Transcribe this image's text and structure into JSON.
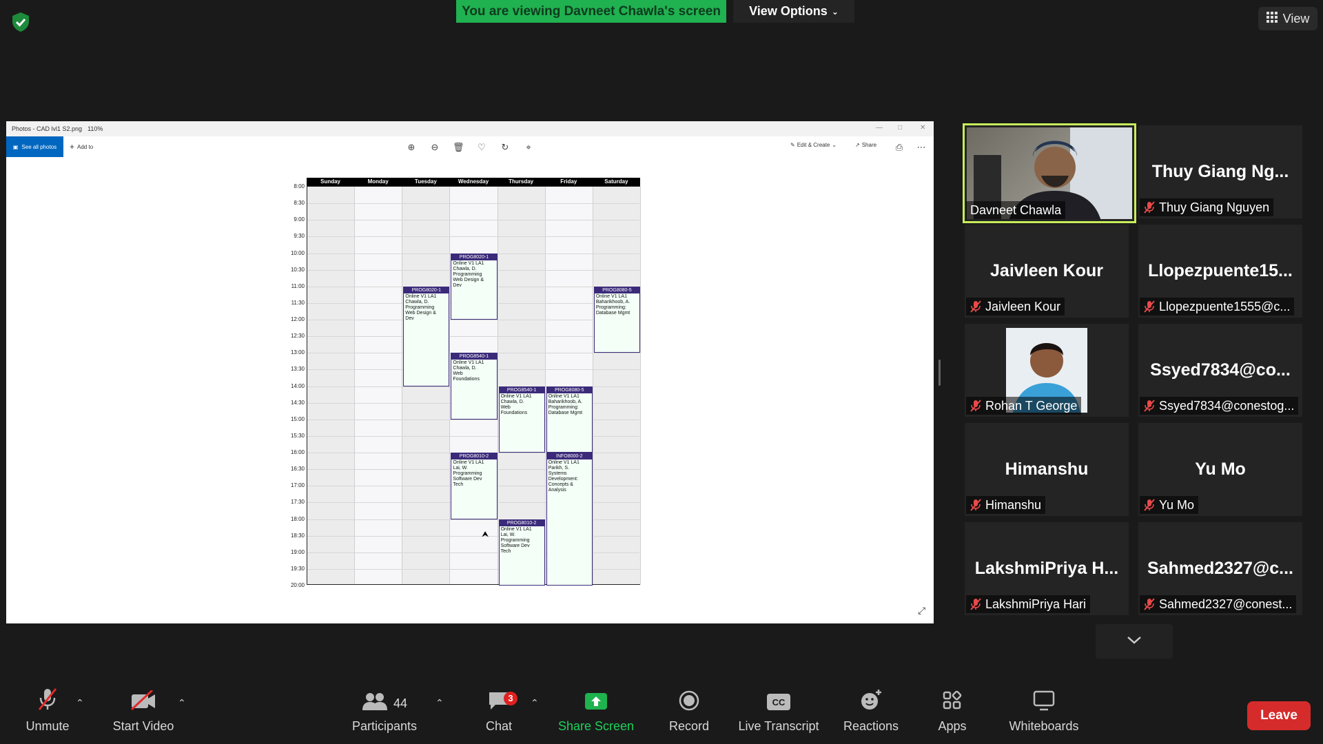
{
  "top": {
    "viewing_banner": "You are viewing Davneet Chawla's screen",
    "view_options": "View Options",
    "view": "View"
  },
  "photos": {
    "title": "Photos - CAD lvl1 S2.png",
    "zoom": "110%",
    "see_all": "See all photos",
    "add_to": "Add to",
    "edit_create": "Edit & Create",
    "share": "Share"
  },
  "calendar": {
    "days": [
      "Sunday",
      "Monday",
      "Tuesday",
      "Wednesday",
      "Thursday",
      "Friday",
      "Saturday"
    ],
    "times": [
      "8:00",
      "8:30",
      "9:00",
      "9:30",
      "10:00",
      "10:30",
      "11:00",
      "11:30",
      "12:00",
      "12:30",
      "13:00",
      "13:30",
      "14:00",
      "14:30",
      "15:00",
      "15:30",
      "16:00",
      "16:30",
      "17:00",
      "17:30",
      "18:00",
      "18:30",
      "19:00",
      "19:30",
      "20:00"
    ],
    "events": [
      {
        "day": 3,
        "start": 10.0,
        "end": 12.0,
        "code": "PROG8020-1",
        "text": "Online V1 LA1\nChawla, D.\nProgramming\nWeb Design &\nDev"
      },
      {
        "day": 2,
        "start": 11.0,
        "end": 14.0,
        "code": "PROG8020-1",
        "text": "Online V1 LA1\nChawla, D.\nProgramming\nWeb Design &\nDev"
      },
      {
        "day": 6,
        "start": 11.0,
        "end": 13.0,
        "code": "PROG8080-5",
        "text": "Online V1 LA1\nBaharikhoob, A.\nProgramming:\nDatabase Mgmt"
      },
      {
        "day": 3,
        "start": 13.0,
        "end": 15.0,
        "code": "PROG8540-1",
        "text": "Online V1 LA1\nChawla, D.\nWeb\nFoundations"
      },
      {
        "day": 4,
        "start": 14.0,
        "end": 16.0,
        "code": "PROG8540-1",
        "text": "Online V1 LA1\nChawla, D.\nWeb\nFoundations"
      },
      {
        "day": 5,
        "start": 14.0,
        "end": 16.0,
        "code": "PROG8080-5",
        "text": "Online V1 LA1\nBaharikhoob, A.\nProgramming:\nDatabase Mgmt"
      },
      {
        "day": 3,
        "start": 16.0,
        "end": 18.0,
        "code": "PROG8010-2",
        "text": "Online V1 LA1\nLai, W.\nProgramming\nSoftware Dev\nTech"
      },
      {
        "day": 5,
        "start": 16.0,
        "end": 20.0,
        "code": "INFO8000-2",
        "text": "Online V1 LA1\nParikh, S.\nSystems\nDevelopment:\nConcepts &\nAnalysis"
      },
      {
        "day": 4,
        "start": 18.0,
        "end": 20.0,
        "code": "PROG8010-2",
        "text": "Online V1 LA1\nLai, W.\nProgramming\nSoftware Dev\nTech"
      }
    ]
  },
  "participants": [
    {
      "display": "",
      "name": "Davneet Chawla",
      "video": true,
      "active": true,
      "muted": false
    },
    {
      "display": "Thuy Giang Ng...",
      "name": "Thuy Giang Nguyen",
      "video": false,
      "muted": true
    },
    {
      "display": "Jaivleen Kour",
      "name": "Jaivleen Kour",
      "video": false,
      "muted": true
    },
    {
      "display": "Llopezpuente15...",
      "name": "Llopezpuente1555@c...",
      "video": false,
      "muted": true
    },
    {
      "display": "",
      "name": "Rohan T George",
      "video": true,
      "photo": true,
      "muted": true
    },
    {
      "display": "Ssyed7834@co...",
      "name": "Ssyed7834@conestog...",
      "video": false,
      "muted": true
    },
    {
      "display": "Himanshu",
      "name": "Himanshu",
      "video": false,
      "muted": true
    },
    {
      "display": "Yu Mo",
      "name": "Yu Mo",
      "video": false,
      "muted": true
    },
    {
      "display": "LakshmiPriya  H...",
      "name": "LakshmiPriya Hari",
      "video": false,
      "muted": true
    },
    {
      "display": "Sahmed2327@c...",
      "name": "Sahmed2327@conest...",
      "video": false,
      "muted": true
    }
  ],
  "toolbar": {
    "unmute": "Unmute",
    "start_video": "Start Video",
    "participants": "Participants",
    "participants_count": "44",
    "chat": "Chat",
    "chat_badge": "3",
    "share_screen": "Share Screen",
    "record": "Record",
    "live_transcript": "Live Transcript",
    "reactions": "Reactions",
    "apps": "Apps",
    "whiteboards": "Whiteboards",
    "leave": "Leave"
  },
  "colors": {
    "share_green": "#20b150",
    "leave_red": "#d62b2b",
    "active_border": "#c8ee5a",
    "event_header": "#3b2a7a"
  }
}
